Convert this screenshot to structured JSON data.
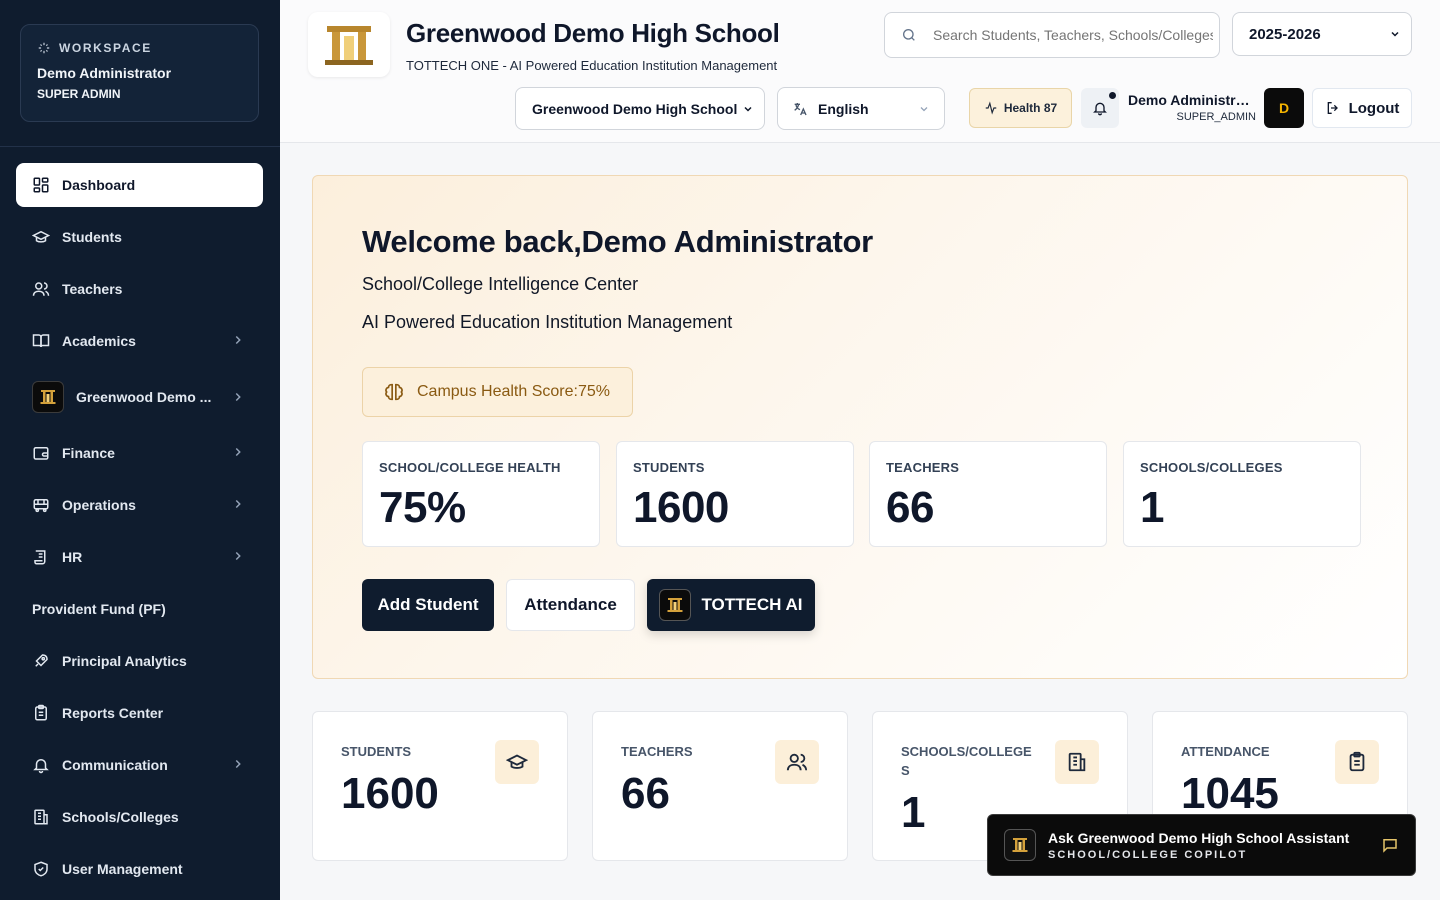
{
  "sidebar": {
    "workspace_label": "WORKSPACE",
    "user_name": "Demo Administrator",
    "user_role": "SUPER ADMIN",
    "items": [
      {
        "label": "Dashboard",
        "icon": "grid-icon",
        "active": true
      },
      {
        "label": "Students",
        "icon": "graduation-cap-icon"
      },
      {
        "label": "Teachers",
        "icon": "users-icon"
      },
      {
        "label": "Academics",
        "icon": "book-open-icon",
        "chevron": true
      },
      {
        "label": "Greenwood Demo ...",
        "icon": "school-logo-icon",
        "chevron": true
      },
      {
        "label": "Finance",
        "icon": "wallet-icon",
        "chevron": true
      },
      {
        "label": "Operations",
        "icon": "bus-icon",
        "chevron": true
      },
      {
        "label": "HR",
        "icon": "scroll-icon",
        "chevron": true
      },
      {
        "label": "Provident Fund (PF)"
      },
      {
        "label": "Principal Analytics",
        "icon": "rocket-icon"
      },
      {
        "label": "Reports Center",
        "icon": "clipboard-icon"
      },
      {
        "label": "Communication",
        "icon": "bell-icon",
        "chevron": true
      },
      {
        "label": "Schools/Colleges",
        "icon": "building-icon"
      },
      {
        "label": "User Management",
        "icon": "shield-icon"
      }
    ]
  },
  "header": {
    "school_name": "Greenwood Demo High School",
    "subtitle": "TOTTECH ONE - AI Powered Education Institution Management",
    "search_placeholder": "Search Students, Teachers, Schools/Colleges",
    "year": "2025-2026",
    "school_select": "Greenwood Demo High School",
    "language": "English",
    "health_badge": "Health 87",
    "user_name": "Demo Administrator",
    "user_role": "SUPER_ADMIN",
    "avatar_letter": "D",
    "logout_label": "Logout"
  },
  "hero": {
    "welcome": "Welcome back,Demo Administrator",
    "line1": "School/College Intelligence Center",
    "line2": "AI Powered Education Institution Management",
    "campus_health": "Campus Health Score:75%",
    "cards": [
      {
        "label": "SCHOOL/COLLEGE HEALTH",
        "value": "75%"
      },
      {
        "label": "STUDENTS",
        "value": "1600"
      },
      {
        "label": "TEACHERS",
        "value": "66"
      },
      {
        "label": "SCHOOLS/COLLEGES",
        "value": "1"
      }
    ],
    "btn_add_student": "Add Student",
    "btn_attendance": "Attendance",
    "btn_ai": "TOTTECH AI"
  },
  "stats": [
    {
      "label": "STUDENTS",
      "value": "1600",
      "icon": "graduation-cap-icon"
    },
    {
      "label": "TEACHERS",
      "value": "66",
      "icon": "users-icon"
    },
    {
      "label": "SCHOOLS/COLLEGE S",
      "value": "1",
      "icon": "building-icon"
    },
    {
      "label": "ATTENDANCE",
      "value": "1045",
      "icon": "clipboard-icon"
    }
  ],
  "assistant": {
    "title": "Ask Greenwood Demo High School Assistant",
    "subtitle": "SCHOOL/COLLEGE COPILOT"
  },
  "colors": {
    "sidebar_bg": "#0f1c2e",
    "accent_gold": "#f5b400",
    "hero_border": "#f0d8b4"
  }
}
